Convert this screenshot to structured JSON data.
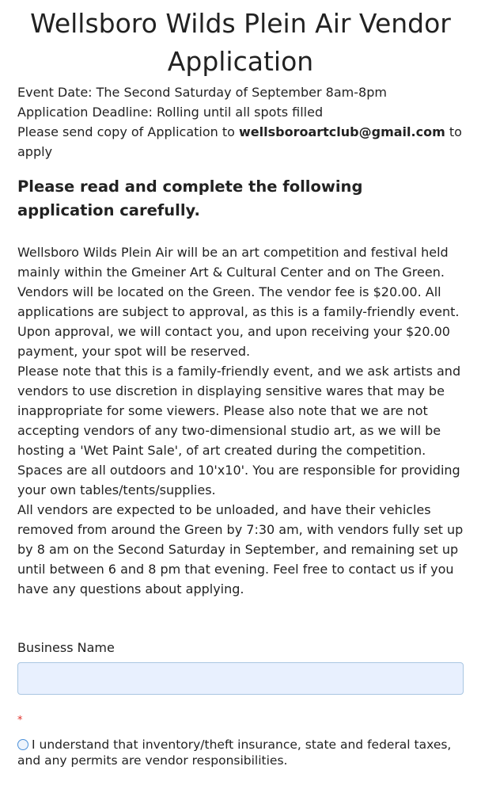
{
  "header": {
    "title": "Wellsboro Wilds Plein Air Vendor Application"
  },
  "info": {
    "event_date": "Event Date: The Second Saturday of September 8am-8pm",
    "deadline": "Application Deadline: Rolling until all spots filled",
    "send_prefix": "Please send copy of Application to ",
    "email": "wellsboroartclub@gmail.com",
    "send_suffix": " to apply"
  },
  "heading": "Please read and complete the following application carefully.",
  "description": {
    "p1": "Wellsboro Wilds Plein Air will be an art competition and festival held mainly within the Gmeiner Art & Cultural Center and on The Green. Vendors will be located on the Green. The vendor fee is $20.00. All applications are subject to approval, as this is a family-friendly event. Upon approval, we will contact you, and upon receiving your $20.00 payment, your spot will be reserved.",
    "p2": "Please note that this is a family-friendly event, and we ask artists and vendors to use discretion in displaying sensitive wares that may be inappropriate for some viewers. Please also note that we are not accepting vendors of any two-dimensional studio art, as we will be hosting a 'Wet Paint Sale', of art created during the competition. Spaces are all outdoors and 10'x10'. You are responsible for providing your own tables/tents/supplies.",
    "p3": "All vendors are expected to be unloaded, and have their vehicles removed from around the Green by 7:30 am, with vendors fully set up by 8 am on the Second Saturday in September, and remaining set up until between 6 and 8 pm that evening. Feel free to contact us if you have any questions about applying."
  },
  "form": {
    "business_name_label": "Business Name",
    "business_name_value": "",
    "required_marker": "*",
    "agreement_label": "I understand that inventory/theft insurance, state and federal taxes, and any permits are vendor responsibilities."
  },
  "colors": {
    "input_background": "#e8f0fe",
    "input_border": "#a9c6e2",
    "required": "#e0302a",
    "radio_border": "#4a90d9"
  }
}
